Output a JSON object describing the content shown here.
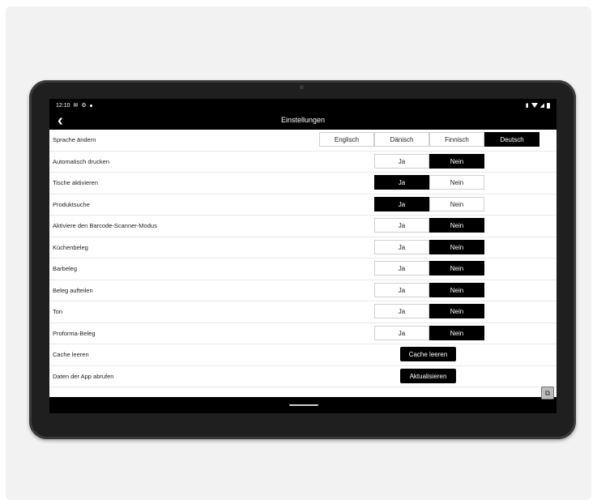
{
  "status_bar": {
    "time": "12:10",
    "left_icons": [
      "mail-icon",
      "gear-icon",
      "dot-icon"
    ],
    "right_icons": [
      "vibrate-icon",
      "wifi-icon",
      "signal-icon",
      "battery-icon"
    ]
  },
  "header": {
    "back_icon": "chevron-left-icon",
    "back_glyph": "‹",
    "title": "Einstellungen"
  },
  "settings": {
    "language": {
      "label": "Sprache ändern",
      "options": [
        "Englisch",
        "Dänisch",
        "Finnisch",
        "Deutsch"
      ],
      "selected": "Deutsch"
    },
    "toggles": [
      {
        "label": "Automatisch drucken",
        "yes": "Ja",
        "no": "Nein",
        "value": "Nein"
      },
      {
        "label": "Tische aktivieren",
        "yes": "Ja",
        "no": "Nein",
        "value": "Ja"
      },
      {
        "label": "Produktsuche",
        "yes": "Ja",
        "no": "Nein",
        "value": "Ja"
      },
      {
        "label": "Aktiviere den Barcode-Scanner-Modus",
        "yes": "Ja",
        "no": "Nein",
        "value": "Nein"
      },
      {
        "label": "Küchenbeleg",
        "yes": "Ja",
        "no": "Nein",
        "value": "Nein"
      },
      {
        "label": "Barbeleg",
        "yes": "Ja",
        "no": "Nein",
        "value": "Nein"
      },
      {
        "label": "Beleg aufteilen",
        "yes": "Ja",
        "no": "Nein",
        "value": "Nein"
      },
      {
        "label": "Ton",
        "yes": "Ja",
        "no": "Nein",
        "value": "Nein"
      },
      {
        "label": "Proforma-Beleg",
        "yes": "Ja",
        "no": "Nein",
        "value": "Nein"
      }
    ],
    "cache": {
      "label": "Cache leeren",
      "button": "Cache leeren"
    },
    "app_data": {
      "label": "Daten der App abrufen",
      "button": "Aktualisieren"
    }
  },
  "corner_icon": "app-switch-icon",
  "colors": {
    "active": "#000000",
    "inactive": "#ffffff",
    "border": "#cfcfcf"
  }
}
